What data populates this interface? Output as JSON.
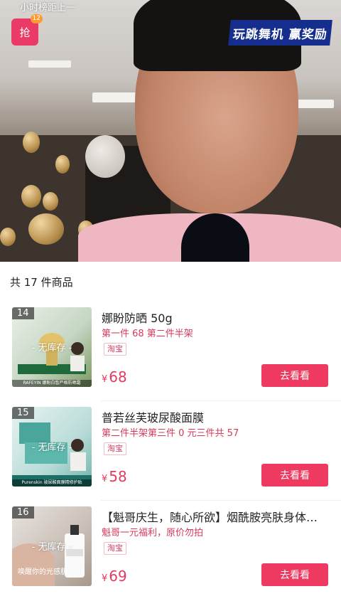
{
  "header": {
    "rank_text": "小时榜距上一",
    "grab_badge": {
      "label": "抢",
      "count": "12"
    },
    "banner": "玩跳舞机 赢奖励"
  },
  "sheet": {
    "title": "共 17 件商品",
    "products": [
      {
        "index": "14",
        "stock": "- 无库存 -",
        "thumb_caption": "RAFEYIN 娜盼白皙严格防晒霜",
        "title": "娜盼防晒 50g",
        "promo": "第一件 68 第二件半架",
        "tag": "淘宝",
        "currency": "¥",
        "price": "68",
        "button": "去看看"
      },
      {
        "index": "15",
        "stock": "- 无库存 -",
        "thumb_caption": "Purenskin 玻尿酸面膜精修护贴",
        "title": "普若丝芙玻尿酸面膜",
        "promo": "第二件半架第三件 0 元三件共 57",
        "tag": "淘宝",
        "currency": "¥",
        "price": "58",
        "button": "去看看"
      },
      {
        "index": "16",
        "stock": "- 无库存 -",
        "thumb_caption": "唤醒你的光感肌",
        "title": "【魁哥庆生，随心所欲】烟酰胺亮肤身体…",
        "promo": "魁哥一元福利，原价勿拍",
        "tag": "淘宝",
        "currency": "¥",
        "price": "69",
        "button": "去看看"
      }
    ]
  }
}
